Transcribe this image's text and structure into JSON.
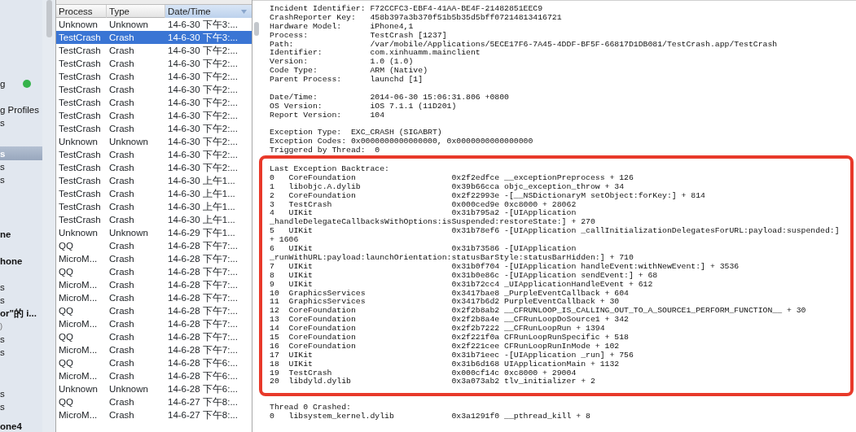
{
  "sidebar": {
    "groups": [
      [
        {
          "label": "g",
          "kind": "item",
          "selected": false,
          "color": "#35b34a"
        }
      ],
      [
        {
          "label": "g Profiles",
          "kind": "item",
          "selected": false
        },
        {
          "label": "s",
          "kind": "item",
          "selected": false
        }
      ],
      [
        {
          "label": "s",
          "kind": "item",
          "selected": true
        },
        {
          "label": "s",
          "kind": "item",
          "selected": false
        },
        {
          "label": "s",
          "kind": "item",
          "selected": false
        }
      ],
      [
        {
          "label": "ne",
          "kind": "device",
          "selected": false
        }
      ],
      [
        {
          "label": "hone",
          "kind": "device",
          "selected": false
        }
      ],
      [
        {
          "label": "s",
          "kind": "item",
          "selected": false
        },
        {
          "label": "s",
          "kind": "item",
          "selected": false
        },
        {
          "label": "or\"的 i...",
          "kind": "device",
          "selected": false
        },
        {
          "label": ")",
          "kind": "detail",
          "selected": false
        },
        {
          "label": "s",
          "kind": "item",
          "selected": false
        },
        {
          "label": "s",
          "kind": "item",
          "selected": false
        }
      ],
      [
        {
          "label": "s",
          "kind": "item",
          "selected": false
        },
        {
          "label": "s",
          "kind": "item",
          "selected": false
        }
      ],
      [
        {
          "label": "one4",
          "kind": "device",
          "selected": false
        }
      ]
    ]
  },
  "table": {
    "columns": [
      {
        "label": "Process",
        "sorted": false
      },
      {
        "label": "Type",
        "sorted": false
      },
      {
        "label": "Date/Time",
        "sorted": true
      }
    ],
    "rows": [
      {
        "cells": [
          "Unknown",
          "Unknown",
          "14-6-30 下午3:..."
        ],
        "selected": false
      },
      {
        "cells": [
          "TestCrash",
          "Crash",
          "14-6-30 下午3:..."
        ],
        "selected": true
      },
      {
        "cells": [
          "TestCrash",
          "Crash",
          "14-6-30 下午2:..."
        ],
        "selected": false
      },
      {
        "cells": [
          "TestCrash",
          "Crash",
          "14-6-30 下午2:..."
        ],
        "selected": false
      },
      {
        "cells": [
          "TestCrash",
          "Crash",
          "14-6-30 下午2:..."
        ],
        "selected": false
      },
      {
        "cells": [
          "TestCrash",
          "Crash",
          "14-6-30 下午2:..."
        ],
        "selected": false
      },
      {
        "cells": [
          "TestCrash",
          "Crash",
          "14-6-30 下午2:..."
        ],
        "selected": false
      },
      {
        "cells": [
          "TestCrash",
          "Crash",
          "14-6-30 下午2:..."
        ],
        "selected": false
      },
      {
        "cells": [
          "TestCrash",
          "Crash",
          "14-6-30 下午2:..."
        ],
        "selected": false
      },
      {
        "cells": [
          "Unknown",
          "Unknown",
          "14-6-30 下午2:..."
        ],
        "selected": false
      },
      {
        "cells": [
          "TestCrash",
          "Crash",
          "14-6-30 下午2:..."
        ],
        "selected": false
      },
      {
        "cells": [
          "TestCrash",
          "Crash",
          "14-6-30 下午2:..."
        ],
        "selected": false
      },
      {
        "cells": [
          "TestCrash",
          "Crash",
          "14-6-30 上午1..."
        ],
        "selected": false
      },
      {
        "cells": [
          "TestCrash",
          "Crash",
          "14-6-30 上午1..."
        ],
        "selected": false
      },
      {
        "cells": [
          "TestCrash",
          "Crash",
          "14-6-30 上午1..."
        ],
        "selected": false
      },
      {
        "cells": [
          "TestCrash",
          "Crash",
          "14-6-30 上午1..."
        ],
        "selected": false
      },
      {
        "cells": [
          "Unknown",
          "Unknown",
          "14-6-29 下午1..."
        ],
        "selected": false
      },
      {
        "cells": [
          "QQ",
          "Crash",
          "14-6-28 下午7:..."
        ],
        "selected": false
      },
      {
        "cells": [
          "MicroM...",
          "Crash",
          "14-6-28 下午7:..."
        ],
        "selected": false
      },
      {
        "cells": [
          "QQ",
          "Crash",
          "14-6-28 下午7:..."
        ],
        "selected": false
      },
      {
        "cells": [
          "MicroM...",
          "Crash",
          "14-6-28 下午7:..."
        ],
        "selected": false
      },
      {
        "cells": [
          "MicroM...",
          "Crash",
          "14-6-28 下午7:..."
        ],
        "selected": false
      },
      {
        "cells": [
          "QQ",
          "Crash",
          "14-6-28 下午7:..."
        ],
        "selected": false
      },
      {
        "cells": [
          "MicroM...",
          "Crash",
          "14-6-28 下午7:..."
        ],
        "selected": false
      },
      {
        "cells": [
          "QQ",
          "Crash",
          "14-6-28 下午7:..."
        ],
        "selected": false
      },
      {
        "cells": [
          "MicroM...",
          "Crash",
          "14-6-28 下午7:..."
        ],
        "selected": false
      },
      {
        "cells": [
          "QQ",
          "Crash",
          "14-6-28 下午6:..."
        ],
        "selected": false
      },
      {
        "cells": [
          "MicroM...",
          "Crash",
          "14-6-28 下午6:..."
        ],
        "selected": false
      },
      {
        "cells": [
          "Unknown",
          "Unknown",
          "14-6-28 下午6:..."
        ],
        "selected": false
      },
      {
        "cells": [
          "QQ",
          "Crash",
          "14-6-27 下午8:..."
        ],
        "selected": false
      },
      {
        "cells": [
          "MicroM...",
          "Crash",
          "14-6-27 下午8:..."
        ],
        "selected": false
      }
    ]
  },
  "report": {
    "header_sections": [
      [
        "Incident Identifier: F72CCFC3-EBF4-41AA-BE4F-21482851EEC9",
        "CrashReporter Key:   458b397a3b370f51b5b35d5bff07214813416721",
        "Hardware Model:      iPhone4,1",
        "Process:             TestCrash [1237]",
        "Path:                /var/mobile/Applications/5ECE17F6-7A45-4DDF-BF5F-66817D1DB081/TestCrash.app/TestCrash",
        "Identifier:          com.xinhuamm.mainclient",
        "Version:             1.0 (1.0)",
        "Code Type:           ARM (Native)",
        "Parent Process:      launchd [1]"
      ],
      [
        "Date/Time:           2014-06-30 15:06:31.806 +0800",
        "OS Version:          iOS 7.1.1 (11D201)",
        "Report Version:      104"
      ],
      [
        "Exception Type:  EXC_CRASH (SIGABRT)",
        "Exception Codes: 0x0000000000000000, 0x0000000000000000",
        "Triggered by Thread:  0"
      ]
    ],
    "backtrace": {
      "title": "Last Exception Backtrace:",
      "highlighted": true,
      "frames": [
        {
          "index": "0",
          "library": "CoreFoundation",
          "address": "0x2f2edfce",
          "symbol": "__exceptionPreprocess + 126"
        },
        {
          "index": "1",
          "library": "libobjc.A.dylib",
          "address": "0x39b66cca",
          "symbol": "objc_exception_throw + 34"
        },
        {
          "index": "2",
          "library": "CoreFoundation",
          "address": "0x2f22993e",
          "symbol": "-[__NSDictionaryM setObject:forKey:] + 814"
        },
        {
          "index": "3",
          "library": "TestCrash",
          "address": "0x000ced9e",
          "symbol": "0xc8000 + 28062"
        },
        {
          "index": "4",
          "library": "UIKit",
          "address": "0x31b795a2",
          "symbol": "-[UIApplication",
          "continuation": "_handleDelegateCallbacksWithOptions:isSuspended:restoreState:] + 270"
        },
        {
          "index": "5",
          "library": "UIKit",
          "address": "0x31b78ef6",
          "symbol": "-[UIApplication _callInitializationDelegatesForURL:payload:suspended:]",
          "continuation": "+ 1606"
        },
        {
          "index": "6",
          "library": "UIKit",
          "address": "0x31b73586",
          "symbol": "-[UIApplication",
          "continuation": "_runWithURL:payload:launchOrientation:statusBarStyle:statusBarHidden:] + 710"
        },
        {
          "index": "7",
          "library": "UIKit",
          "address": "0x31b0f704",
          "symbol": "-[UIApplication handleEvent:withNewEvent:] + 3536"
        },
        {
          "index": "8",
          "library": "UIKit",
          "address": "0x31b0e86c",
          "symbol": "-[UIApplication sendEvent:] + 68"
        },
        {
          "index": "9",
          "library": "UIKit",
          "address": "0x31b72cc4",
          "symbol": "_UIApplicationHandleEvent + 612"
        },
        {
          "index": "10",
          "library": "GraphicsServices",
          "address": "0x3417bae8",
          "symbol": "_PurpleEventCallback + 604"
        },
        {
          "index": "11",
          "library": "GraphicsServices",
          "address": "0x3417b6d2",
          "symbol": "PurpleEventCallback + 30"
        },
        {
          "index": "12",
          "library": "CoreFoundation",
          "address": "0x2f2b8ab2",
          "symbol": "__CFRUNLOOP_IS_CALLING_OUT_TO_A_SOURCE1_PERFORM_FUNCTION__ + 30"
        },
        {
          "index": "13",
          "library": "CoreFoundation",
          "address": "0x2f2b8a4e",
          "symbol": "__CFRunLoopDoSource1 + 342"
        },
        {
          "index": "14",
          "library": "CoreFoundation",
          "address": "0x2f2b7222",
          "symbol": "__CFRunLoopRun + 1394"
        },
        {
          "index": "15",
          "library": "CoreFoundation",
          "address": "0x2f221f0a",
          "symbol": "CFRunLoopRunSpecific + 518"
        },
        {
          "index": "16",
          "library": "CoreFoundation",
          "address": "0x2f221cee",
          "symbol": "CFRunLoopRunInMode + 102"
        },
        {
          "index": "17",
          "library": "UIKit",
          "address": "0x31b71eec",
          "symbol": "-[UIApplication _run] + 756"
        },
        {
          "index": "18",
          "library": "UIKit",
          "address": "0x31b6d168",
          "symbol": "UIApplicationMain + 1132"
        },
        {
          "index": "19",
          "library": "TestCrash",
          "address": "0x000cf14c",
          "symbol": "0xc8000 + 29004"
        },
        {
          "index": "20",
          "library": "libdyld.dylib",
          "address": "0x3a073ab2",
          "symbol": "tlv_initializer + 2"
        }
      ]
    },
    "crashed_thread": {
      "title": "Thread 0 Crashed:",
      "frames": [
        {
          "index": "0",
          "library": "libsystem_kernel.dylib",
          "address": "0x3a1291f0",
          "symbol": "__pthread_kill + 8"
        }
      ]
    }
  }
}
